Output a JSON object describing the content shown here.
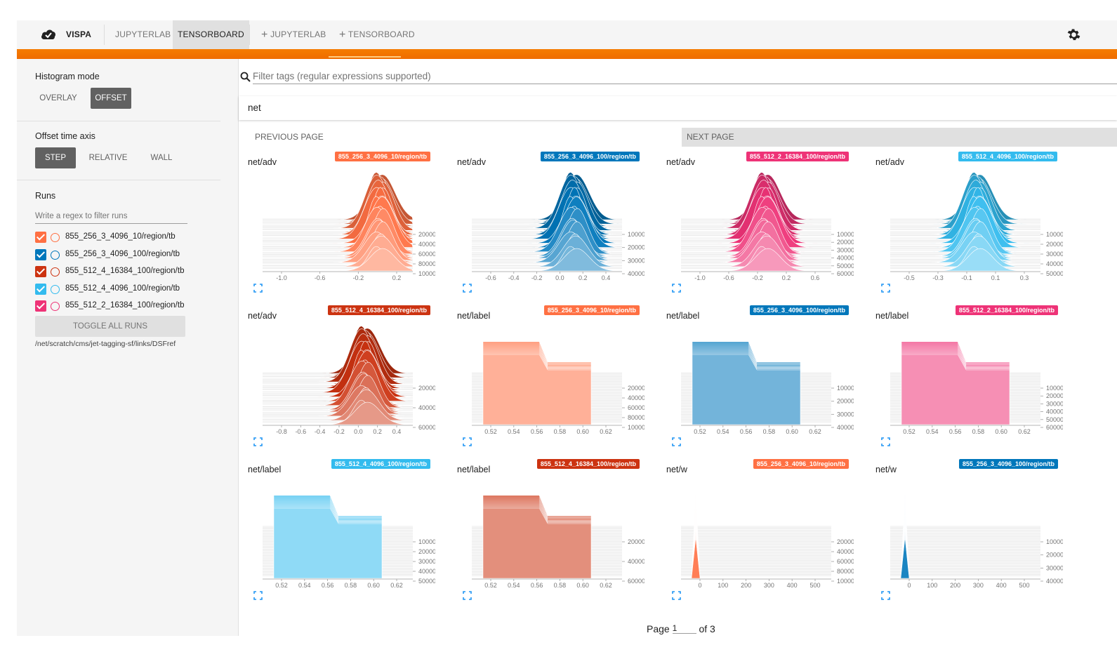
{
  "topbar": {
    "brand": "VISPA",
    "tabs": [
      "JUPYTERLAB",
      "TENSORBOARD"
    ],
    "new_tabs": [
      "JUPYTERLAB",
      "TENSORBOARD"
    ],
    "new_tab_icon": "plus-icon",
    "brand_icon": "cloud-icon",
    "settings_icon": "gear-icon"
  },
  "sidebar": {
    "histogram_mode_label": "Histogram mode",
    "histogram_modes": [
      "OVERLAY",
      "OFFSET"
    ],
    "histogram_mode_selected": "OFFSET",
    "offset_axis_label": "Offset time axis",
    "offset_axes": [
      "STEP",
      "RELATIVE",
      "WALL"
    ],
    "offset_axis_selected": "STEP",
    "runs_label": "Runs",
    "runs_filter_placeholder": "Write a regex to filter runs",
    "runs": [
      {
        "name": "855_256_3_4096_10/region/tb",
        "color": "#ff7043",
        "checked": true
      },
      {
        "name": "855_256_3_4096_100/region/tb",
        "color": "#0077bb",
        "checked": true
      },
      {
        "name": "855_512_4_16384_100/region/tb",
        "color": "#cc3311",
        "checked": true
      },
      {
        "name": "855_512_4_4096_100/region/tb",
        "color": "#33bbee",
        "checked": true
      },
      {
        "name": "855_512_2_16384_100/region/tb",
        "color": "#ee3377",
        "checked": true
      }
    ],
    "toggle_all": "TOGGLE ALL RUNS",
    "logdir": "/net/scratch/cms/jet-tagging-sf/links/DSFref"
  },
  "main": {
    "filter_placeholder": "Filter tags (regular expressions supported)",
    "filter_icon": "search-icon",
    "group_name": "net",
    "prev_page": "PREVIOUS PAGE",
    "next_page": "NEXT PAGE",
    "pager": {
      "label": "Page",
      "current": "1",
      "of": "of 3"
    },
    "expand_icon": "fullscreen-icon"
  },
  "chart_data": [
    {
      "type": "area",
      "tag": "net/adv",
      "run": "855_256_3_4096_10/region/tb",
      "color": "#ff7043",
      "kind": "adv",
      "x_ticks": [
        "-1.0",
        "-0.6",
        "-0.2",
        "0.2"
      ],
      "y_ticks": [
        "20000",
        "40000",
        "60000",
        "80000",
        "100000"
      ],
      "peak": 0.78
    },
    {
      "type": "area",
      "tag": "net/adv",
      "run": "855_256_3_4096_100/region/tb",
      "color": "#0077bb",
      "kind": "adv",
      "x_ticks": [
        "-0.6",
        "-0.4",
        "-0.2",
        "0.0",
        "0.2",
        "0.4"
      ],
      "y_ticks": [
        "100000",
        "200000",
        "300000",
        "400000"
      ],
      "peak": 0.68
    },
    {
      "type": "area",
      "tag": "net/adv",
      "run": "855_512_2_16384_100/region/tb",
      "color": "#ee3377",
      "kind": "adv",
      "x_ticks": [
        "-1.0",
        "-0.6",
        "-0.2",
        "0.2",
        "0.6"
      ],
      "y_ticks": [
        "100000",
        "200000",
        "300000",
        "400000",
        "500000",
        "600000"
      ],
      "peak": 0.56
    },
    {
      "type": "area",
      "tag": "net/adv",
      "run": "855_512_4_4096_100/region/tb",
      "color": "#33bbee",
      "kind": "adv",
      "x_ticks": [
        "-0.5",
        "-0.3",
        "-0.1",
        "0.1",
        "0.3"
      ],
      "y_ticks": [
        "100000",
        "200000",
        "300000",
        "400000",
        "500000"
      ],
      "peak": 0.58
    },
    {
      "type": "area",
      "tag": "net/adv",
      "run": "855_512_4_16384_100/region/tb",
      "color": "#cc3311",
      "kind": "adv",
      "x_ticks": [
        "-0.8",
        "-0.6",
        "-0.4",
        "-0.2",
        "0.0",
        "0.2",
        "0.4"
      ],
      "y_ticks": [
        "200000",
        "400000",
        "600000"
      ],
      "peak": 0.68
    },
    {
      "type": "area",
      "tag": "net/label",
      "run": "855_256_3_4096_10/region/tb",
      "color": "#ff7043",
      "kind": "label",
      "x_ticks": [
        "0.52",
        "0.54",
        "0.56",
        "0.58",
        "0.60",
        "0.62"
      ],
      "y_ticks": [
        "20000",
        "40000",
        "60000",
        "80000",
        "100000"
      ]
    },
    {
      "type": "area",
      "tag": "net/label",
      "run": "855_256_3_4096_100/region/tb",
      "color": "#0077bb",
      "kind": "label",
      "x_ticks": [
        "0.52",
        "0.54",
        "0.56",
        "0.58",
        "0.60",
        "0.62"
      ],
      "y_ticks": [
        "100000",
        "200000",
        "300000",
        "400000"
      ]
    },
    {
      "type": "area",
      "tag": "net/label",
      "run": "855_512_2_16384_100/region/tb",
      "color": "#ee3377",
      "kind": "label",
      "x_ticks": [
        "0.52",
        "0.54",
        "0.56",
        "0.58",
        "0.60",
        "0.62"
      ],
      "y_ticks": [
        "100000",
        "200000",
        "300000",
        "400000",
        "500000",
        "600000"
      ]
    },
    {
      "type": "area",
      "tag": "net/label",
      "run": "855_512_4_4096_100/region/tb",
      "color": "#33bbee",
      "kind": "label",
      "x_ticks": [
        "0.52",
        "0.54",
        "0.56",
        "0.58",
        "0.60",
        "0.62"
      ],
      "y_ticks": [
        "100000",
        "200000",
        "300000",
        "400000",
        "500000"
      ]
    },
    {
      "type": "area",
      "tag": "net/label",
      "run": "855_512_4_16384_100/region/tb",
      "color": "#cc3311",
      "kind": "label",
      "x_ticks": [
        "0.52",
        "0.54",
        "0.56",
        "0.58",
        "0.60",
        "0.62"
      ],
      "y_ticks": [
        "200000",
        "400000",
        "600000"
      ]
    },
    {
      "type": "area",
      "tag": "net/w",
      "run": "855_256_3_4096_10/region/tb",
      "color": "#ff7043",
      "kind": "w",
      "x_ticks": [
        "0",
        "100",
        "200",
        "300",
        "400",
        "500"
      ],
      "y_ticks": [
        "20000",
        "40000",
        "60000",
        "80000",
        "100000"
      ]
    },
    {
      "type": "area",
      "tag": "net/w",
      "run": "855_256_3_4096_100/region/tb",
      "color": "#0077bb",
      "kind": "w",
      "x_ticks": [
        "0",
        "100",
        "200",
        "300",
        "400",
        "500"
      ],
      "y_ticks": [
        "100000",
        "200000",
        "300000",
        "400000"
      ]
    }
  ]
}
